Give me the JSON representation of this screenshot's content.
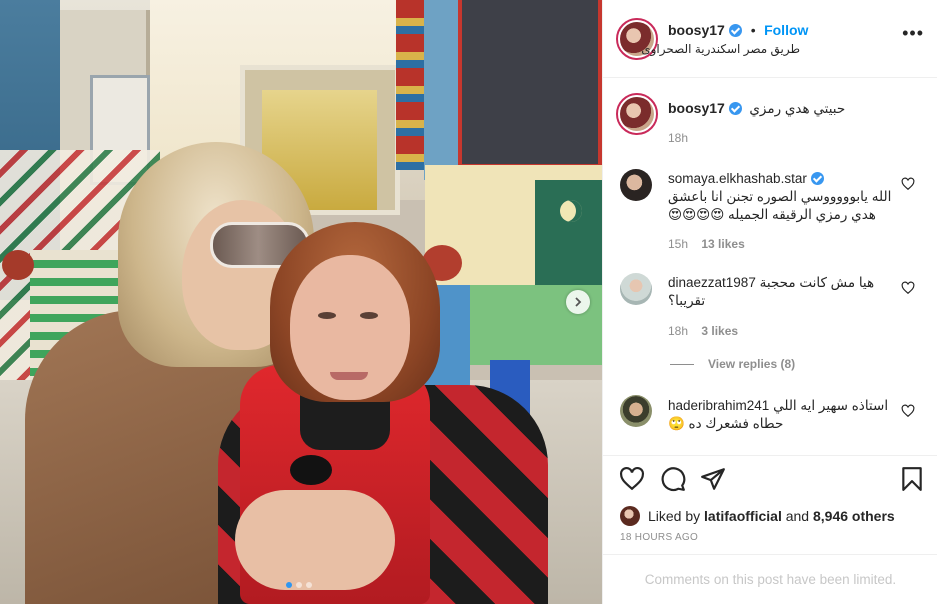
{
  "post": {
    "carousel_dots": 3,
    "active_dot": 0
  },
  "header": {
    "username": "boosy17",
    "follow_label": "Follow",
    "separator": "•",
    "location": "طريق مصر اسكندرية الصحراوى",
    "more_label": "•••"
  },
  "caption": {
    "username": "boosy17",
    "text": "حبيتي هدي رمزي",
    "time": "18h"
  },
  "comments": [
    {
      "username": "somaya.elkhashab.star",
      "verified": true,
      "text": "الله يابوووووسي الصوره تجنن انا باعشق هدي رمزي الرقيقه الجميله 😍😍😍😍",
      "time": "15h",
      "likes": "13 likes"
    },
    {
      "username": "dinaezzat1987",
      "verified": false,
      "text": "هيا مش كانت محجبة تقريبا؟",
      "time": "18h",
      "likes": "3 likes",
      "view_replies": "View replies (8)"
    },
    {
      "username": "haderibrahim241",
      "verified": false,
      "text": "استاذه سهير ايه اللي حطاه فشعرك ده 🙄"
    }
  ],
  "likes": {
    "prefix": "Liked by",
    "user": "latifaofficial",
    "joiner": "and",
    "others": "8,946 others"
  },
  "timestamp": "18 HOURS AGO",
  "limited_notice": "Comments on this post have been limited.",
  "colors": {
    "follow_blue": "#0095f6",
    "verified_blue": "#3897f0",
    "meta_gray": "#8e8e8e",
    "border": "#efefef"
  },
  "icons": [
    "heart-icon",
    "comment-icon",
    "share-icon",
    "bookmark-icon",
    "more-icon",
    "chevron-right-icon",
    "verified-badge-icon"
  ]
}
